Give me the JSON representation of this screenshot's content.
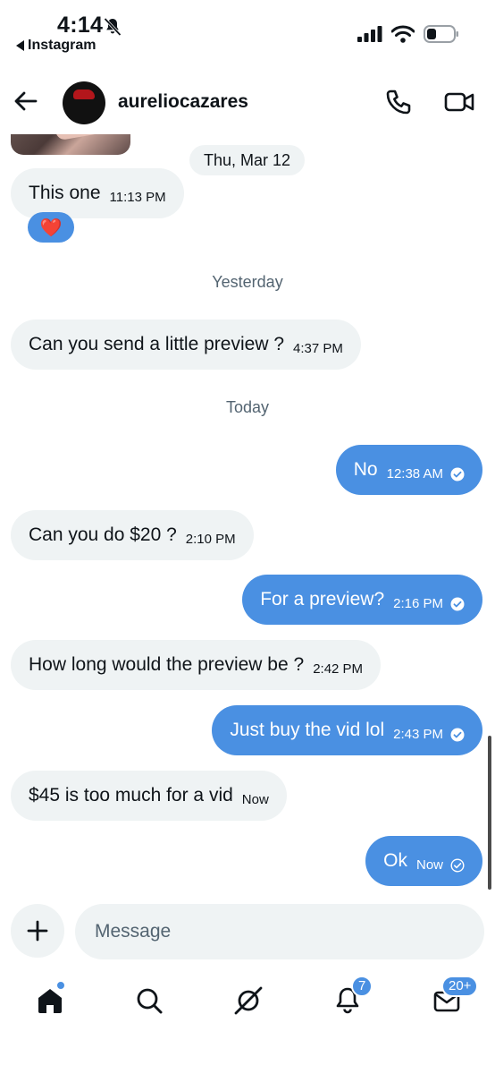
{
  "status_bar": {
    "time": "4:14",
    "back_app_label": "Instagram"
  },
  "header": {
    "username": "aureliocazares"
  },
  "messages": [
    {
      "type": "day",
      "label": "Thu, Mar 12"
    },
    {
      "type": "in",
      "text": "This one",
      "time": "11:13 PM",
      "reaction": "❤️"
    },
    {
      "type": "day",
      "label": "Yesterday"
    },
    {
      "type": "in",
      "text": "Can you send a little preview ?",
      "time": "4:37 PM"
    },
    {
      "type": "day",
      "label": "Today"
    },
    {
      "type": "out",
      "text": "No",
      "time": "12:38 AM",
      "status": "read"
    },
    {
      "type": "in",
      "text": "Can you do $20 ?",
      "time": "2:10 PM"
    },
    {
      "type": "out",
      "text": "For a preview?",
      "time": "2:16 PM",
      "status": "read"
    },
    {
      "type": "in",
      "text": "How long would the preview be ?",
      "time": "2:42 PM"
    },
    {
      "type": "out",
      "text": "Just buy the vid lol",
      "time": "2:43 PM",
      "status": "read"
    },
    {
      "type": "in",
      "text": "$45 is too much for a vid",
      "time": "Now"
    },
    {
      "type": "out",
      "text": "Ok",
      "time": "Now",
      "status": "sent"
    }
  ],
  "composer": {
    "placeholder": "Message"
  },
  "tabbar": {
    "home": {
      "icon": "home-icon",
      "has_dot": true
    },
    "search": {
      "icon": "search-icon"
    },
    "grok": {
      "icon": "grok-icon"
    },
    "notifications": {
      "icon": "bell-icon",
      "badge": "7"
    },
    "messages": {
      "icon": "envelope-icon",
      "badge": "20+"
    }
  },
  "colors": {
    "accent": "#4a90e2",
    "incoming_bubble": "#eff3f4",
    "secondary_text": "#536471"
  }
}
